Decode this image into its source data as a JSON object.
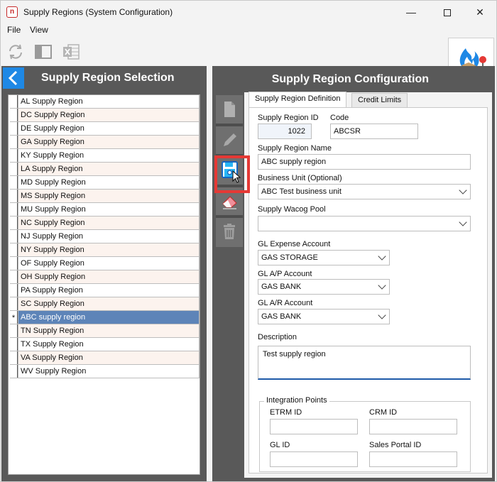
{
  "window": {
    "title": "Supply Regions (System Configuration)",
    "app_icon": "n",
    "controls": {
      "minimize": "—",
      "close": "✕"
    }
  },
  "menu": {
    "file": "File",
    "view": "View"
  },
  "left_panel": {
    "title": "Supply Region Selection",
    "items": [
      {
        "label": "AL Supply Region",
        "indicator": ""
      },
      {
        "label": "DC Supply Region",
        "indicator": ""
      },
      {
        "label": "DE Supply Region",
        "indicator": ""
      },
      {
        "label": "GA Supply Region",
        "indicator": ""
      },
      {
        "label": "KY Supply Region",
        "indicator": ""
      },
      {
        "label": "LA Supply Region",
        "indicator": ""
      },
      {
        "label": "MD Supply Region",
        "indicator": ""
      },
      {
        "label": "MS Supply Region",
        "indicator": ""
      },
      {
        "label": "MU Supply Region",
        "indicator": ""
      },
      {
        "label": "NC Supply Region",
        "indicator": ""
      },
      {
        "label": "NJ Supply Region",
        "indicator": ""
      },
      {
        "label": "NY Supply Region",
        "indicator": ""
      },
      {
        "label": "OF Supply Region",
        "indicator": ""
      },
      {
        "label": "OH Supply Region",
        "indicator": ""
      },
      {
        "label": "PA Supply Region",
        "indicator": ""
      },
      {
        "label": "SC Supply Region",
        "indicator": ""
      },
      {
        "label": "ABC supply region",
        "indicator": "*"
      },
      {
        "label": "TN Supply Region",
        "indicator": ""
      },
      {
        "label": "TX Supply Region",
        "indicator": ""
      },
      {
        "label": "VA Supply Region",
        "indicator": ""
      },
      {
        "label": "WV Supply Region",
        "indicator": ""
      }
    ],
    "selected_index": 16
  },
  "right_panel": {
    "title": "Supply Region Configuration",
    "tabs": [
      "Supply Region Definition",
      "Credit Limits"
    ],
    "active_tab": 0,
    "side_buttons": [
      "new-document-icon",
      "edit-pencil-icon",
      "save-disk-icon",
      "eraser-icon",
      "trash-icon"
    ],
    "form": {
      "supply_region_id_label": "Supply Region ID",
      "supply_region_id": "1022",
      "code_label": "Code",
      "code": "ABCSR",
      "name_label": "Supply Region Name",
      "name": "ABC supply region",
      "business_unit_label": "Business Unit (Optional)",
      "business_unit": "ABC Test business unit",
      "wacog_label": "Supply Wacog Pool",
      "wacog": "",
      "gl_expense_label": "GL Expense Account",
      "gl_expense": "GAS STORAGE",
      "gl_ap_label": "GL A/P Account",
      "gl_ap": "GAS BANK",
      "gl_ar_label": "GL A/R Account",
      "gl_ar": "GAS BANK",
      "description_label": "Description",
      "description": "Test supply region",
      "integration_title": "Integration Points",
      "etrm_label": "ETRM ID",
      "etrm": "",
      "crm_label": "CRM ID",
      "crm": "",
      "gl_id_label": "GL ID",
      "gl_id": "",
      "sales_portal_label": "Sales Portal ID",
      "sales_portal": ""
    }
  },
  "colors": {
    "panel_bg": "#595959",
    "selected_row": "#5d84b8",
    "accent_blue": "#1e88e5",
    "highlight_red": "#e53935"
  }
}
